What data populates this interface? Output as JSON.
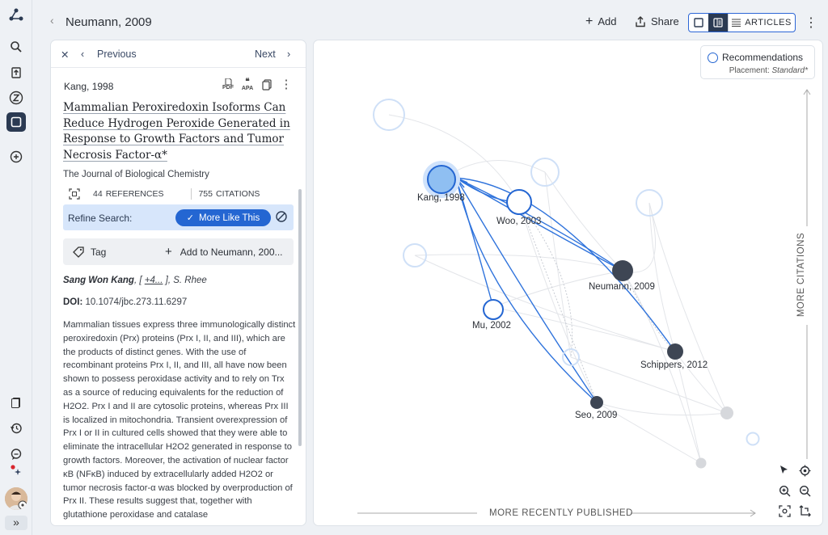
{
  "topbar": {
    "title": "Neumann, 2009",
    "add_label": "Add",
    "share_label": "Share",
    "articles_label": "ARTICLES"
  },
  "panel": {
    "nav": {
      "previous": "Previous",
      "next": "Next"
    },
    "article_id": "Kang, 1998",
    "icons": [
      "pdf-icon",
      "apa-icon",
      "copy-icon",
      "more-icon"
    ],
    "icon_texts": {
      "pdf": "PDF",
      "apa": "APA"
    },
    "title": "Mammalian Peroxiredoxin Isoforms Can Reduce Hydrogen Peroxide Generated in Response to Growth Factors and Tumor Necrosis Factor-α*",
    "journal": "The Journal of Biological Chemistry",
    "references_count": "44",
    "references_label": "REFERENCES",
    "citations_count": "755",
    "citations_label": "CITATIONS",
    "refine_label": "Refine Search:",
    "more_like_this": "More Like This",
    "tag_label": "Tag",
    "add_to_label": "Add to Neumann, 200...",
    "author_first": "Sang Won Kang",
    "author_more": "+4...",
    "author_last": "S. Rhee",
    "doi_label": "DOI:",
    "doi": "10.1074/jbc.273.11.6297",
    "abstract": "Mammalian tissues express three immunologically distinct peroxiredoxin (Prx) proteins (Prx I, II, and III), which are the products of distinct genes. With the use of recombinant proteins Prx I, II, and III, all have now been shown to possess peroxidase activity and to rely on Trx as a source of reducing equivalents for the reduction of H2O2. Prx I and II are cytosolic proteins, whereas Prx III is localized in mitochondria. Transient overexpression of Prx I or II in cultured cells showed that they were able to eliminate the intracellular H2O2 generated in response to growth factors. Moreover, the activation of nuclear factor κB (NFκB) induced by extracellularly added H2O2 or tumor necrosis factor-α was blocked by overproduction of Prx II. These results suggest that, together with glutathione peroxidase and catalase"
  },
  "graph": {
    "legend_title": "Recommendations",
    "placement_label": "Placement:",
    "placement_value": "Standard*",
    "x_axis_label": "MORE RECENTLY PUBLISHED",
    "y_axis_label": "MORE CITATIONS",
    "labels": {
      "kang": "Kang, 1998",
      "woo": "Woo, 2003",
      "neumann": "Neumann, 2009",
      "mu": "Mu, 2002",
      "schippers": "Schippers, 2012",
      "seo": "Seo, 2009"
    }
  },
  "rail": {
    "icons": [
      "graph-logo-icon",
      "search-icon",
      "upload-icon",
      "zotero-icon",
      "graph-view-icon",
      "add-icon",
      "library-icon",
      "history-icon",
      "chat-icon",
      "sparkle-icon",
      "avatar",
      "expand-icon"
    ]
  },
  "colors": {
    "accent": "#2466d2",
    "selected_fill": "#8fbff2",
    "dark_node": "#3e4654",
    "light_ring": "#cfe0f7"
  }
}
